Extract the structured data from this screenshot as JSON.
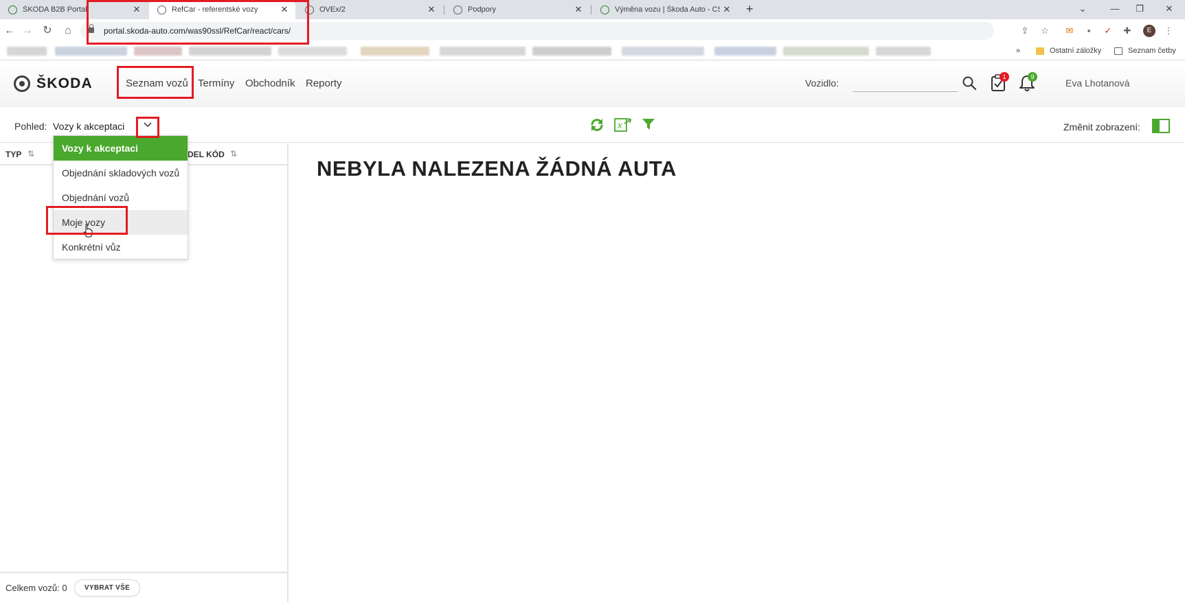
{
  "browser": {
    "tabs": [
      {
        "title": "ŠKODA B2B Portal"
      },
      {
        "title": "RefCar - referentské vozy"
      },
      {
        "title": "OVEx/2"
      },
      {
        "title": "Podpory"
      },
      {
        "title": "Výměna vozu | Škoda Auto - CSS"
      }
    ],
    "new_tab_symbol": "+",
    "url": "portal.skoda-auto.com/was90ssl/RefCar/react/cars/",
    "bookmarks_overflow": "»",
    "bookmark_folder_other": "Ostatní záložky",
    "reading_list": "Seznam četby",
    "profile_initial": "E"
  },
  "app": {
    "logo_text": "ŠKODA",
    "nav": {
      "seznam_vozu": "Seznam vozů",
      "terminy": "Termíny",
      "obchodnik": "Obchodník",
      "reporty": "Reporty"
    },
    "vozidlo_label": "Vozidlo:",
    "vozidlo_value": "",
    "tasks_badge": "1",
    "notifications_badge": "9",
    "user_name": "Eva Lhotanová",
    "colors": {
      "accent": "#4ba82e",
      "badge_red": "#e31b23",
      "badge_green": "#4ba82e",
      "annotation": "#e31b23"
    }
  },
  "viewbar": {
    "pohled_label": "Pohled:",
    "pohled_value": "Vozy k akceptaci",
    "zmenit_label": "Změnit zobrazení:"
  },
  "dropdown": {
    "items": [
      {
        "label": "Vozy k akceptaci"
      },
      {
        "label": "Objednání skladových vozů"
      },
      {
        "label": "Objednání vozů"
      },
      {
        "label": "Moje vozy"
      },
      {
        "label": "Konkrétní vůz"
      }
    ]
  },
  "table": {
    "columns": [
      {
        "label": "TYP"
      },
      {
        "label": "DEL KÓD"
      }
    ]
  },
  "footer": {
    "total_label": "Celkem vozů: 0",
    "select_all": "VYBRAT VŠE"
  },
  "main": {
    "empty_message": "NEBYLA NALEZENA ŽÁDNÁ AUTA"
  }
}
